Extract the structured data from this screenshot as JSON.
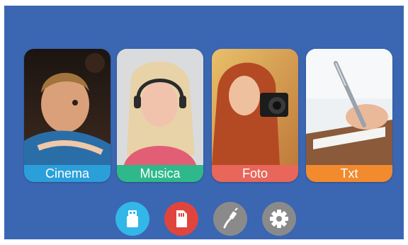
{
  "tiles": [
    {
      "label": "Cinema",
      "color": "#2b9fd9",
      "icon": "cinema-photo"
    },
    {
      "label": "Musica",
      "color": "#2fb98a",
      "icon": "music-photo"
    },
    {
      "label": "Foto",
      "color": "#e8665a",
      "icon": "photo-camera-photo"
    },
    {
      "label": "Txt",
      "color": "#f28a2e",
      "icon": "text-writing-photo"
    }
  ],
  "dock": [
    {
      "icon": "usb-icon",
      "color": "#33b6e8"
    },
    {
      "icon": "sd-card-icon",
      "color": "#e0453d"
    },
    {
      "icon": "cable-icon",
      "color": "#8a8a8a"
    },
    {
      "icon": "settings-icon",
      "color": "#8a8a8a"
    }
  ],
  "theme": {
    "background": "#3a66b2"
  }
}
